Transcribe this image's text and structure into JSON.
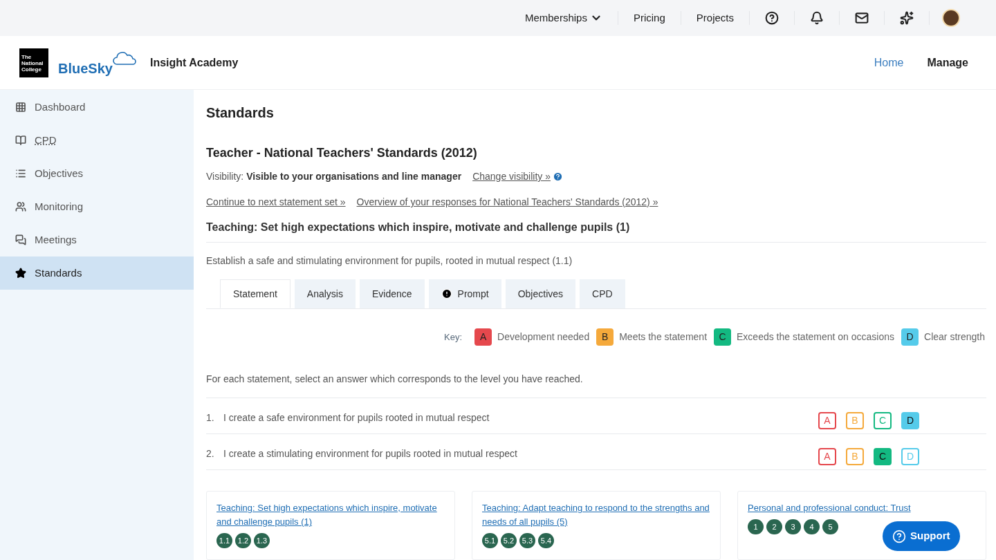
{
  "top_nav": {
    "links": [
      {
        "label": "Memberships",
        "kind": "dropdown"
      },
      {
        "label": "Pricing",
        "kind": "link"
      },
      {
        "label": "Projects",
        "kind": "link"
      }
    ]
  },
  "header": {
    "logo_box": "The National College",
    "logo_text": "BlueSky",
    "school": "Insight Academy",
    "nav": [
      {
        "label": "Home",
        "selected": true
      },
      {
        "label": "Manage",
        "selected": false
      }
    ]
  },
  "sidebar": {
    "items": [
      {
        "label": "Dashboard",
        "selected": false,
        "abbreviation": false
      },
      {
        "label": "CPD",
        "selected": false,
        "abbreviation": true
      },
      {
        "label": "Objectives",
        "selected": false,
        "abbreviation": false
      },
      {
        "label": "Monitoring",
        "selected": false,
        "abbreviation": false
      },
      {
        "label": "Meetings",
        "selected": false,
        "abbreviation": false
      },
      {
        "label": "Standards",
        "selected": true,
        "abbreviation": false
      }
    ]
  },
  "main": {
    "title": "Standards",
    "set_title": "Teacher - National Teachers' Standards (2012)",
    "visibility": {
      "label": "Visibility:",
      "value": "Visible to your organisations and line manager",
      "link": "Change visibility »"
    },
    "links": [
      "Continue to next statement set »",
      "Overview of your responses for National Teachers' Standards (2012) »"
    ],
    "section": "Teaching: Set high expectations which inspire, motivate and challenge pupils (1)",
    "subsection": "Establish a safe and stimulating environment for pupils, rooted in mutual respect (1.1)",
    "tabs": [
      {
        "label": "Statement",
        "selected": true,
        "alert": false
      },
      {
        "label": "Analysis",
        "selected": false,
        "alert": false
      },
      {
        "label": "Evidence",
        "selected": false,
        "alert": false
      },
      {
        "label": "Prompt",
        "selected": false,
        "alert": true
      },
      {
        "label": "Objectives",
        "selected": false,
        "alert": false
      },
      {
        "label": "CPD",
        "selected": false,
        "alert": false
      }
    ],
    "key": {
      "label": "Key:",
      "items": [
        {
          "letter": "A",
          "text": "Development needed",
          "color": "#e5484d"
        },
        {
          "letter": "B",
          "text": "Meets the statement",
          "color": "#f5a93b"
        },
        {
          "letter": "C",
          "text": "Exceeds the statement on occasions",
          "color": "#13b981"
        },
        {
          "letter": "D",
          "text": "Clear strength",
          "color": "#55cbea"
        }
      ]
    },
    "instruction": "For each statement, select an answer which corresponds to the level you have reached.",
    "statements": [
      {
        "number": "1.",
        "text": "I create a safe environment for pupils rooted in mutual respect",
        "options": [
          {
            "letter": "A",
            "color": "#e5484d",
            "selected": false
          },
          {
            "letter": "B",
            "color": "#f5a93b",
            "selected": false
          },
          {
            "letter": "C",
            "color": "#13b981",
            "selected": false
          },
          {
            "letter": "D",
            "color": "#55cbea",
            "selected": true
          }
        ]
      },
      {
        "number": "2.",
        "text": "I create a stimulating environment for pupils rooted in mutual respect",
        "options": [
          {
            "letter": "A",
            "color": "#e5484d",
            "selected": false
          },
          {
            "letter": "B",
            "color": "#f5a93b",
            "selected": false
          },
          {
            "letter": "C",
            "color": "#13b981",
            "selected": true
          },
          {
            "letter": "D",
            "color": "#55cbea",
            "selected": false
          }
        ]
      }
    ],
    "cards": [
      {
        "title": "Teaching: Set high expectations which inspire, motivate and challenge pupils (1)",
        "badges": [
          "1.1",
          "1.2",
          "1.3"
        ]
      },
      {
        "title": "Teaching: Adapt teaching to respond to the strengths and needs of all pupils (5)",
        "badges": [
          "5.1",
          "5.2",
          "5.3",
          "5.4"
        ]
      },
      {
        "title": "Personal and professional conduct: Trust",
        "badges": [
          "1",
          "2",
          "3",
          "4",
          "5"
        ]
      }
    ],
    "support_button": "Support"
  }
}
